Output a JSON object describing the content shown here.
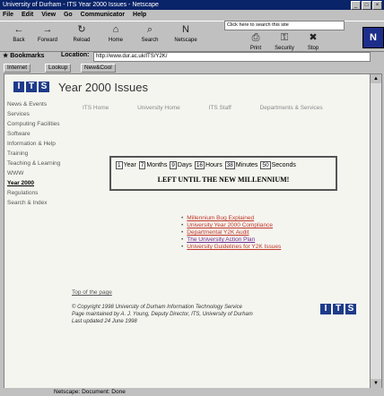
{
  "window": {
    "title": "University of Durham - ITS Year 2000 Issues - Netscape"
  },
  "menu": [
    "File",
    "Edit",
    "View",
    "Go",
    "Communicator",
    "Help"
  ],
  "toolbar": [
    {
      "label": "Back",
      "icon": "back-icon",
      "glyph": "←"
    },
    {
      "label": "Forward",
      "icon": "forward-icon",
      "glyph": "→"
    },
    {
      "label": "Reload",
      "icon": "reload-icon",
      "glyph": "↻"
    },
    {
      "label": "Home",
      "icon": "home-icon",
      "glyph": "⌂"
    },
    {
      "label": "Search",
      "icon": "search-icon",
      "glyph": "⌕"
    },
    {
      "label": "Netscape",
      "icon": "netscape-icon",
      "glyph": "N"
    },
    {
      "label": "Print",
      "icon": "print-icon",
      "glyph": "⎙"
    },
    {
      "label": "Security",
      "icon": "lock-icon",
      "glyph": "⚿"
    },
    {
      "label": "Stop",
      "icon": "stop-icon",
      "glyph": "✖"
    }
  ],
  "search_field": "Click here to search this site",
  "bookmarks_label": "Bookmarks",
  "location_label": "Location:",
  "location_url": "http://www.dur.ac.uk/ITS/Y2K/",
  "personal_toolbar": [
    "Internet",
    "Lookup",
    "New&Cool"
  ],
  "content": {
    "logo_letters": [
      "I",
      "T",
      "S"
    ],
    "page_title": "Year 2000 Issues",
    "sidebar": [
      {
        "label": "News & Events",
        "current": false
      },
      {
        "label": "Services",
        "current": false
      },
      {
        "label": "Computing Facilities",
        "current": false
      },
      {
        "label": "Software",
        "current": false
      },
      {
        "label": "Information & Help",
        "current": false
      },
      {
        "label": "Training",
        "current": false
      },
      {
        "label": "Teaching & Learning",
        "current": false
      },
      {
        "label": "WWW",
        "current": false
      },
      {
        "label": "Year 2000",
        "current": true
      },
      {
        "label": "Regulations",
        "current": false
      },
      {
        "label": "Search & Index",
        "current": false
      }
    ],
    "topnav": [
      "ITS Home",
      "University Home",
      "ITS Staff",
      "Departments & Services"
    ],
    "countdown": {
      "years": "1",
      "years_label": "Year",
      "months": "7",
      "months_label": "Months",
      "days": "9",
      "days_label": "Days",
      "hours": "16",
      "hours_label": "Hours",
      "minutes": "38",
      "minutes_label": "Minutes",
      "seconds": "50",
      "seconds_label": "Seconds",
      "message": "LEFT UNTIL THE NEW MILLENNIUM!"
    },
    "links": [
      {
        "text": "Millennium Bug Explained",
        "visited": false
      },
      {
        "text": "University Year 2000 Compliance",
        "visited": false
      },
      {
        "text": "Departmental Y2K Audit",
        "visited": false
      },
      {
        "text": "The University Action Plan",
        "visited": true
      },
      {
        "text": "University Guidelines for Y2K Issues",
        "visited": false
      }
    ],
    "top_link": "Top of the page",
    "footer": {
      "line1": "© Copyright 1998 University of Durham Information Technology Service",
      "line2": "Page maintained by A. J. Young, Deputy Director, ITS, University of Durham",
      "line3": "Last updated 24 June 1998"
    }
  },
  "status_text": "Netscape: Document: Done"
}
